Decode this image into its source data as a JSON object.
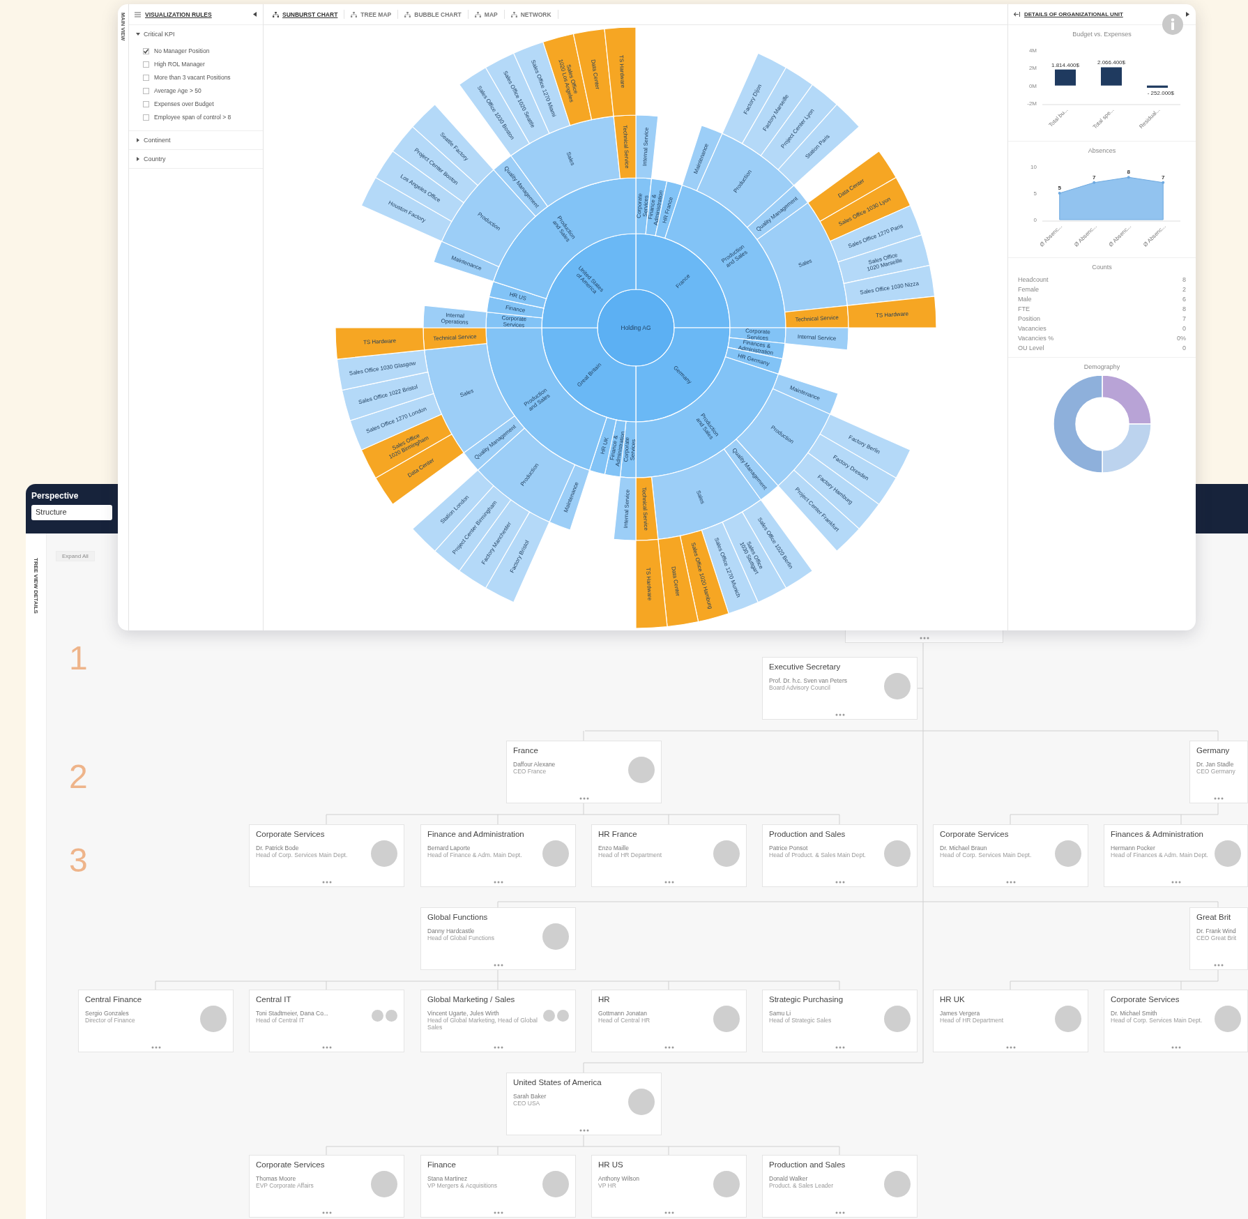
{
  "main_window": {
    "side_tab": "MAIN VIEW",
    "rules_panel": {
      "title": "VISUALIZATION RULES",
      "groups": [
        {
          "label": "Critical KPI",
          "expanded": true,
          "rules": [
            {
              "label": "No Manager Position",
              "checked": true
            },
            {
              "label": "High ROL Manager",
              "checked": false
            },
            {
              "label": "More than 3 vacant Positions",
              "checked": false
            },
            {
              "label": "Average Age > 50",
              "checked": false
            },
            {
              "label": "Expenses over Budget",
              "checked": false
            },
            {
              "label": "Employee span of control > 8",
              "checked": false
            }
          ]
        },
        {
          "label": "Continent",
          "expanded": false
        },
        {
          "label": "Country",
          "expanded": false
        }
      ]
    },
    "tabs": [
      {
        "label": "SUNBURST CHART",
        "selected": true
      },
      {
        "label": "TREE MAP",
        "selected": false
      },
      {
        "label": "BUBBLE CHART",
        "selected": false
      },
      {
        "label": "MAP",
        "selected": false
      },
      {
        "label": "NETWORK",
        "selected": false
      }
    ],
    "sunburst": {
      "root": {
        "label": "Holding AG",
        "highlighted": false,
        "children": [
          {
            "label": "France",
            "highlighted": false,
            "children": [
              {
                "label": "Corporate Services",
                "highlighted": false,
                "children": [
                  {
                    "label": "Internal Service",
                    "highlighted": false
                  }
                ]
              },
              {
                "label": "Finance & Administration",
                "highlighted": false
              },
              {
                "label": "HR France",
                "highlighted": false
              },
              {
                "label": "Production and Sales",
                "highlighted": false,
                "children": [
                  {
                    "label": "Maintenance",
                    "highlighted": false
                  },
                  {
                    "label": "Production",
                    "highlighted": false,
                    "children": [
                      {
                        "label": "Factory Dijon",
                        "highlighted": false
                      },
                      {
                        "label": "Factory Marseille",
                        "highlighted": false
                      },
                      {
                        "label": "Project Center Lyon",
                        "highlighted": false
                      },
                      {
                        "label": "Station Paris",
                        "highlighted": false
                      }
                    ]
                  },
                  {
                    "label": "Quality Management",
                    "highlighted": false
                  },
                  {
                    "label": "Sales",
                    "highlighted": false,
                    "children": [
                      {
                        "label": "Data Center",
                        "highlighted": true
                      },
                      {
                        "label": "Sales Office 1030 Lyon",
                        "highlighted": true
                      },
                      {
                        "label": "Sales Office 1270 Paris",
                        "highlighted": false
                      },
                      {
                        "label": "Sales Office 1020 Marseille",
                        "highlighted": false
                      },
                      {
                        "label": "Sales Office 1030 Nizza",
                        "highlighted": false
                      }
                    ]
                  },
                  {
                    "label": "Technical Service",
                    "highlighted": true,
                    "children": [
                      {
                        "label": "TS Hardware",
                        "highlighted": true
                      }
                    ]
                  }
                ]
              }
            ]
          },
          {
            "label": "Germany",
            "highlighted": false,
            "children": [
              {
                "label": "Corporate Services",
                "highlighted": false,
                "children": [
                  {
                    "label": "Internal Service",
                    "highlighted": false
                  }
                ]
              },
              {
                "label": "Finances & Administration",
                "highlighted": false
              },
              {
                "label": "HR Germany",
                "highlighted": false
              },
              {
                "label": "Production and Sales",
                "highlighted": false,
                "children": [
                  {
                    "label": "Maintenance",
                    "highlighted": false
                  },
                  {
                    "label": "Production",
                    "highlighted": false,
                    "children": [
                      {
                        "label": "Factory Berlin",
                        "highlighted": false
                      },
                      {
                        "label": "Factory Dresden",
                        "highlighted": false
                      },
                      {
                        "label": "Factory Hamburg",
                        "highlighted": false
                      },
                      {
                        "label": "Project Center Frankfurt",
                        "highlighted": false
                      }
                    ]
                  },
                  {
                    "label": "Quality Management",
                    "highlighted": false
                  },
                  {
                    "label": "Sales",
                    "highlighted": false,
                    "children": [
                      {
                        "label": "Sales Office 1020 Berlin",
                        "highlighted": false
                      },
                      {
                        "label": "Sales Office 1030 Stuttgart",
                        "highlighted": false
                      },
                      {
                        "label": "Sales Office 1270 Munich",
                        "highlighted": false
                      },
                      {
                        "label": "Sales Office 1020 Hamburg",
                        "highlighted": true
                      },
                      {
                        "label": "Data Center",
                        "highlighted": true
                      }
                    ]
                  },
                  {
                    "label": "Technical Service",
                    "highlighted": true,
                    "children": [
                      {
                        "label": "TS Hardware",
                        "highlighted": true
                      }
                    ]
                  }
                ]
              }
            ]
          },
          {
            "label": "Great Britain",
            "highlighted": false,
            "children": [
              {
                "label": "Corporate Services",
                "highlighted": false,
                "children": [
                  {
                    "label": "Internal Service",
                    "highlighted": false
                  }
                ]
              },
              {
                "label": "Finance & Administration",
                "highlighted": false
              },
              {
                "label": "HR UK",
                "highlighted": false
              },
              {
                "label": "Production and Sales",
                "highlighted": false,
                "children": [
                  {
                    "label": "Maintenance",
                    "highlighted": false
                  },
                  {
                    "label": "Production",
                    "highlighted": false,
                    "children": [
                      {
                        "label": "Factory Bristol",
                        "highlighted": false
                      },
                      {
                        "label": "Factory Manchester",
                        "highlighted": false
                      },
                      {
                        "label": "Project Center Birmingham",
                        "highlighted": false
                      },
                      {
                        "label": "Station London",
                        "highlighted": false
                      }
                    ]
                  },
                  {
                    "label": "Quality Management",
                    "highlighted": false
                  },
                  {
                    "label": "Sales",
                    "highlighted": false,
                    "children": [
                      {
                        "label": "Data Center",
                        "highlighted": true
                      },
                      {
                        "label": "Sales Office 1020 Birmingham",
                        "highlighted": true
                      },
                      {
                        "label": "Sales Office 1270 London",
                        "highlighted": false
                      },
                      {
                        "label": "Sales Office 1022 Bristol",
                        "highlighted": false
                      },
                      {
                        "label": "Sales Office 1030 Glasgow",
                        "highlighted": false
                      }
                    ]
                  },
                  {
                    "label": "Technical Service",
                    "highlighted": true,
                    "children": [
                      {
                        "label": "TS Hardware",
                        "highlighted": true
                      }
                    ]
                  }
                ]
              }
            ]
          },
          {
            "label": "United States of America",
            "highlighted": false,
            "children": [
              {
                "label": "Corporate Services",
                "highlighted": false,
                "children": [
                  {
                    "label": "Internal Operations",
                    "highlighted": false
                  }
                ]
              },
              {
                "label": "Finance",
                "highlighted": false
              },
              {
                "label": "HR US",
                "highlighted": false
              },
              {
                "label": "Production and Sales",
                "highlighted": false,
                "children": [
                  {
                    "label": "Maintenance",
                    "highlighted": false
                  },
                  {
                    "label": "Production",
                    "highlighted": false,
                    "children": [
                      {
                        "label": "Houston Factory",
                        "highlighted": false
                      },
                      {
                        "label": "Los Angeles Office",
                        "highlighted": false
                      },
                      {
                        "label": "Project Center Boston",
                        "highlighted": false
                      },
                      {
                        "label": "Seattle Factory",
                        "highlighted": false
                      }
                    ]
                  },
                  {
                    "label": "Quality Management",
                    "highlighted": false
                  },
                  {
                    "label": "Sales",
                    "highlighted": false,
                    "children": [
                      {
                        "label": "Sales Office 1030 Boston",
                        "highlighted": false
                      },
                      {
                        "label": "Sales Office 1020 Seattle",
                        "highlighted": false
                      },
                      {
                        "label": "Sales Office 1270 Miami",
                        "highlighted": false
                      },
                      {
                        "label": "Sales Office 1020 Los Angeles",
                        "highlighted": true
                      },
                      {
                        "label": "Data Center",
                        "highlighted": true
                      }
                    ]
                  },
                  {
                    "label": "Technical Service",
                    "highlighted": true,
                    "children": [
                      {
                        "label": "TS Hardware",
                        "highlighted": true
                      }
                    ]
                  }
                ]
              }
            ]
          }
        ]
      }
    },
    "details_panel": {
      "title": "DETAILS OF ORGANIZATIONAL UNIT",
      "budget": {
        "chart_data": {
          "type": "bar",
          "title": "Budget vs. Expenses",
          "categories": [
            "Total bu...",
            "Total spe...",
            "Residual..."
          ],
          "series": [
            {
              "color": "#1f3a5f",
              "values": [
                1814400,
                2066400,
                -252000
              ]
            }
          ],
          "ylim": [
            -2000000,
            4000000
          ],
          "yticks": [
            {
              "value": -2000000,
              "label": "-2M"
            },
            {
              "value": 0,
              "label": "0M"
            },
            {
              "value": 2000000,
              "label": "2M"
            },
            {
              "value": 4000000,
              "label": "4M"
            }
          ],
          "value_labels": [
            "1.814.400$",
            "2.066.400$",
            "- 252.000$"
          ]
        }
      },
      "absences": {
        "chart_data": {
          "type": "area",
          "title": "Absences",
          "categories": [
            "Ø Absenc...",
            "Ø Absenc...",
            "Ø Absenc...",
            "Ø Absenc..."
          ],
          "series": [
            {
              "color": "#92c3ef",
              "values": [
                5,
                7,
                8,
                7
              ]
            }
          ],
          "ylim": [
            0,
            10
          ],
          "yticks": [
            0,
            5,
            10
          ],
          "data_labels": true
        }
      },
      "counts": {
        "title": "Counts",
        "rows": [
          {
            "label": "Headcount",
            "value": "8"
          },
          {
            "label": "Female",
            "value": "2"
          },
          {
            "label": "Male",
            "value": "6"
          },
          {
            "label": "FTE",
            "value": "8"
          },
          {
            "label": "Position",
            "value": "7"
          },
          {
            "label": "Vacancies",
            "value": "0"
          },
          {
            "label": "Vacancies %",
            "value": "0%"
          },
          {
            "label": "OU Level",
            "value": "0"
          }
        ]
      },
      "demography": {
        "title": "Demography"
      }
    }
  },
  "org_view": {
    "perspective_label": "Perspective",
    "perspective_value": "Structure",
    "side_tab": "TREE VIEW DETAILS",
    "expand_button": "Expand All",
    "levels": [
      "1",
      "2",
      "3"
    ],
    "cards": [
      {
        "kind": "empty"
      },
      {
        "kind": "single",
        "title": "Executive Secretary",
        "name": "Prof. Dr. h.c. Sven van Peters",
        "role": "Board Advisory Council"
      },
      {
        "kind": "single",
        "title": "France",
        "name": "Daffour Alexane",
        "role": "CEO France"
      },
      {
        "kind": "none",
        "title": "Germany",
        "name": "Dr. Jan Stadle",
        "role": "CEO Germany"
      },
      {
        "kind": "single",
        "title": "Corporate Services",
        "name": "Dr. Patrick Bode",
        "role": "Head of Corp. Services Main Dept."
      },
      {
        "kind": "single",
        "title": "Finance and Administration",
        "name": "Bernard Laporte",
        "role": "Head of Finance & Adm. Main Dept."
      },
      {
        "kind": "single",
        "title": "HR France",
        "name": "Enzo Maille",
        "role": "Head of HR Department"
      },
      {
        "kind": "single",
        "title": "Production and Sales",
        "name": "Patrice Ponsot",
        "role": "Head of Product. & Sales Main Dept."
      },
      {
        "kind": "single",
        "title": "Corporate Services",
        "name": "Dr. Michael Braun",
        "role": "Head of Corp. Services Main Dept."
      },
      {
        "kind": "single",
        "title": "Finances & Administration",
        "name": "Hermann Pocker",
        "role": "Head of Finances & Adm. Main Dept."
      },
      {
        "kind": "single",
        "title": "Global Functions",
        "name": "Danny Hardcastle",
        "role": "Head of Global Functions"
      },
      {
        "kind": "none",
        "title": "Great Brit",
        "name": "Dr. Frank Wind",
        "role": "CEO Great Brit"
      },
      {
        "kind": "single",
        "title": "Central Finance",
        "name": "Sergio Gonzales",
        "role": "Director of Finance"
      },
      {
        "kind": "pair",
        "title": "Central IT",
        "name": "Toni Stadtmeier, Dana Co...",
        "role": "Head of Central IT"
      },
      {
        "kind": "pair",
        "title": "Global Marketing / Sales",
        "name": "Vincent Ugarte, Jules Wirth",
        "role": "Head of Global Marketing, Head of Global Sales"
      },
      {
        "kind": "single",
        "title": "HR",
        "name": "Gottmann Jonatan",
        "role": "Head of Central HR"
      },
      {
        "kind": "single",
        "title": "Strategic Purchasing",
        "name": "Samu Li",
        "role": "Head of Strategic Sales"
      },
      {
        "kind": "single",
        "title": "HR UK",
        "name": "James Vergera",
        "role": "Head of HR Department"
      },
      {
        "kind": "single",
        "title": "Corporate Services",
        "name": "Dr. Michael Smith",
        "role": "Head of Corp. Services Main Dept."
      },
      {
        "kind": "single",
        "title": "United States of America",
        "name": "Sarah Baker",
        "role": "CEO USA"
      },
      {
        "kind": "single",
        "title": "Corporate Services",
        "name": "Thomas Moore",
        "role": "EVP Corporate Affairs"
      },
      {
        "kind": "single",
        "title": "Finance",
        "name": "Stana Martinez",
        "role": "VP Mergers & Acquisitions"
      },
      {
        "kind": "single",
        "title": "HR US",
        "name": "Anthony Wilson",
        "role": "VP HR"
      },
      {
        "kind": "single",
        "title": "Production and Sales",
        "name": "Donald Walker",
        "role": "Product. & Sales Leader"
      }
    ]
  }
}
